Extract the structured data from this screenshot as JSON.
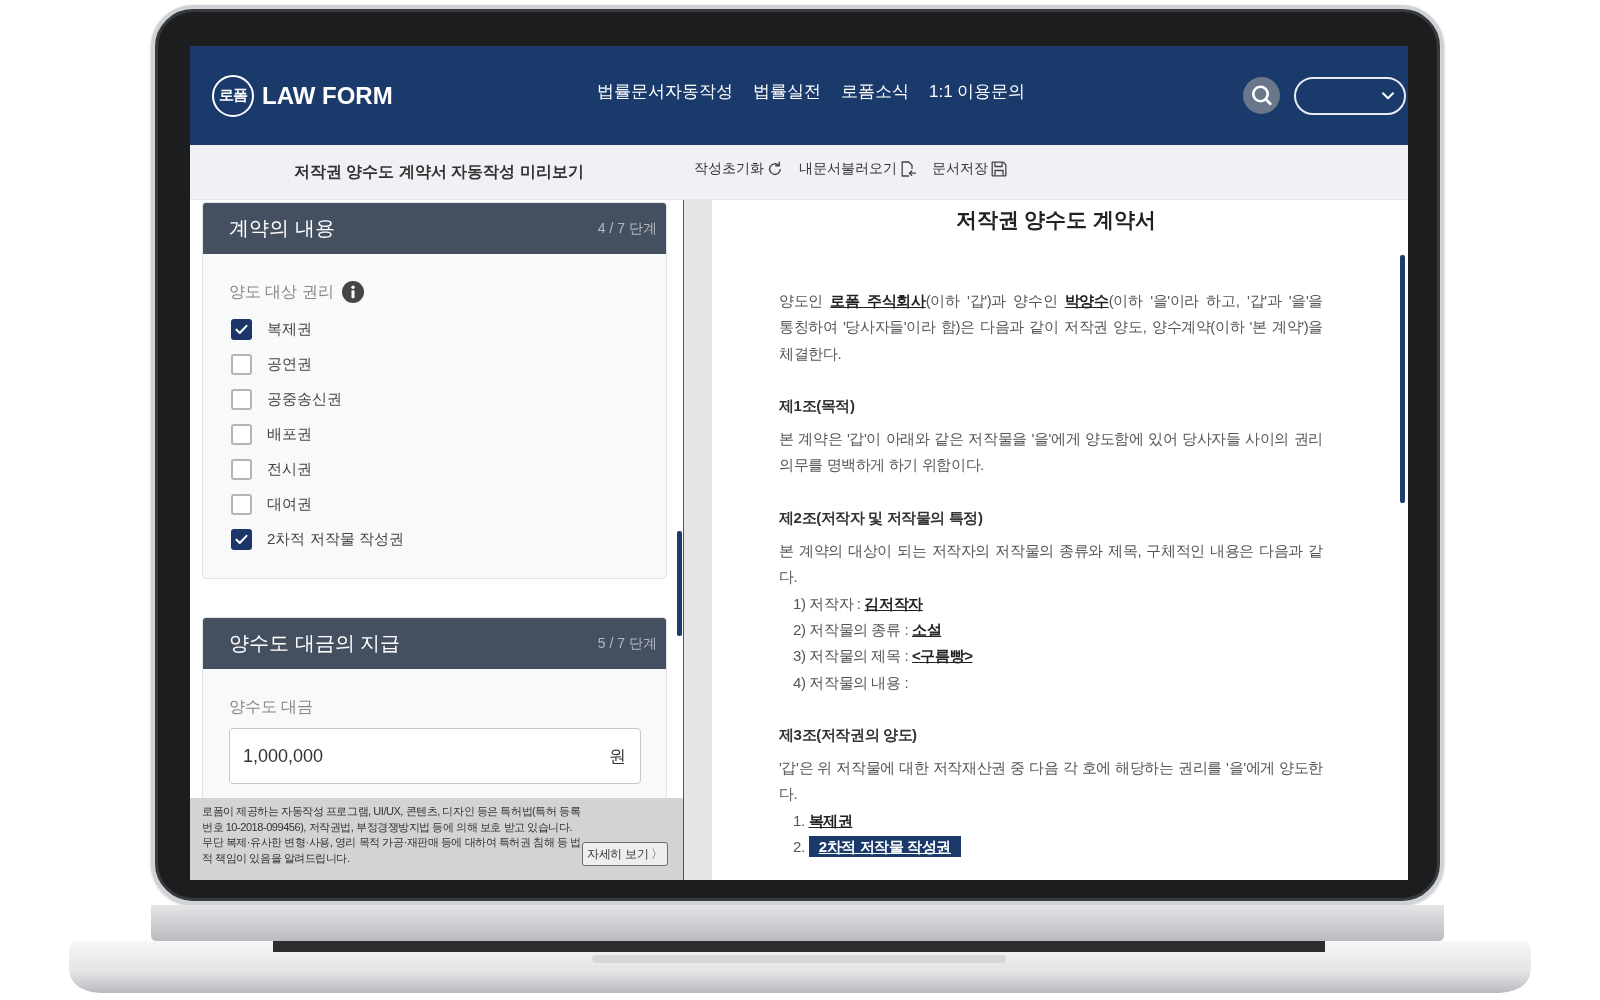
{
  "header": {
    "logo": {
      "emblem": "로폼",
      "name": "LAW FORM"
    },
    "nav": [
      "법률문서자동작성",
      "법률실전",
      "로폼소식",
      "1:1 이용문의"
    ]
  },
  "toolbar": {
    "title": "저작권 양수도 계약서 자동작성 미리보기",
    "actions": [
      {
        "kind": "reset",
        "label": "작성초기화"
      },
      {
        "kind": "load",
        "label": "내문서불러오기"
      },
      {
        "kind": "save",
        "label": "문서저장"
      }
    ]
  },
  "steps": [
    {
      "kind": "checklist",
      "title": "계약의 내용",
      "step": "4 / 7 단계",
      "label": "양도 대상 권리",
      "options": [
        {
          "label": "복제권",
          "checked": true
        },
        {
          "label": "공연권",
          "checked": false
        },
        {
          "label": "공중송신권",
          "checked": false
        },
        {
          "label": "배포권",
          "checked": false
        },
        {
          "label": "전시권",
          "checked": false
        },
        {
          "label": "대여권",
          "checked": false
        },
        {
          "label": "2차적 저작물 작성권",
          "checked": true
        }
      ]
    },
    {
      "kind": "amount",
      "title": "양수도 대금의 지급",
      "step": "5 / 7 단계",
      "label": "양수도 대금",
      "value": "1,000,000",
      "unit": "원"
    }
  ],
  "notice": {
    "text": "로폼이 제공하는 자동작성 프로그램, UI/UX, 콘텐츠, 디자인 등은 특허법(특허 등록번호 10-2018-099456), 저작권법, 부정경쟁방지법 등에 의해 보호 받고 있습니다. 무단 복제·유사한 변형·사용, 영리 목적 가공·재판매 등에 대하여 특허권 침해 등 법적 책임이 있음을 알려드립니다.",
    "button": "자세히 보기 〉"
  },
  "document": {
    "title": "저작권 양수도 계약서",
    "preamble": "양도인 **로폼 주식회사**(이하 '갑')과 양수인 **박양수**(이하 '을'이라 하고, '갑'과 '을'을 통칭하여 '당사자들'이라 함)은 다음과 같이 저작권 양도, 양수계약(이하 '본 계약')을 체결한다.",
    "articles": [
      {
        "heading": "제1조(목적)",
        "body": "본 계약은 '갑'이 아래와 같은 저작물을 '을'에게 양도함에 있어 당사자들 사이의 권리 의무를 명백하게 하기 위함이다."
      },
      {
        "heading": "제2조(저작자 및 저작물의 특정)",
        "body": "본 계약의 대상이 되는 저작자의 저작물의 종류와 제목, 구체적인 내용은 다음과 같다.",
        "items": [
          {
            "kind": "text",
            "text": "1) 저작자 : **김저작자**"
          },
          {
            "kind": "text",
            "text": "2) 저작물의 종류 : **소설**"
          },
          {
            "kind": "text",
            "text": "3) 저작물의 제목 : **<구름빵>**"
          },
          {
            "kind": "text",
            "text": "4) 저작물의 내용 :"
          }
        ]
      },
      {
        "heading": "제3조(저작권의 양도)",
        "body": "'갑'은 위 저작물에 대한 저작재산권 중 다음 각 호에 해당하는 권리를 '을'에게 양도한다.",
        "items": [
          {
            "kind": "right",
            "number": "1.",
            "value": "복제권",
            "highlighted": false
          },
          {
            "kind": "right",
            "number": "2.",
            "value": "2차적 저작물 작성권",
            "highlighted": true
          }
        ]
      }
    ]
  }
}
